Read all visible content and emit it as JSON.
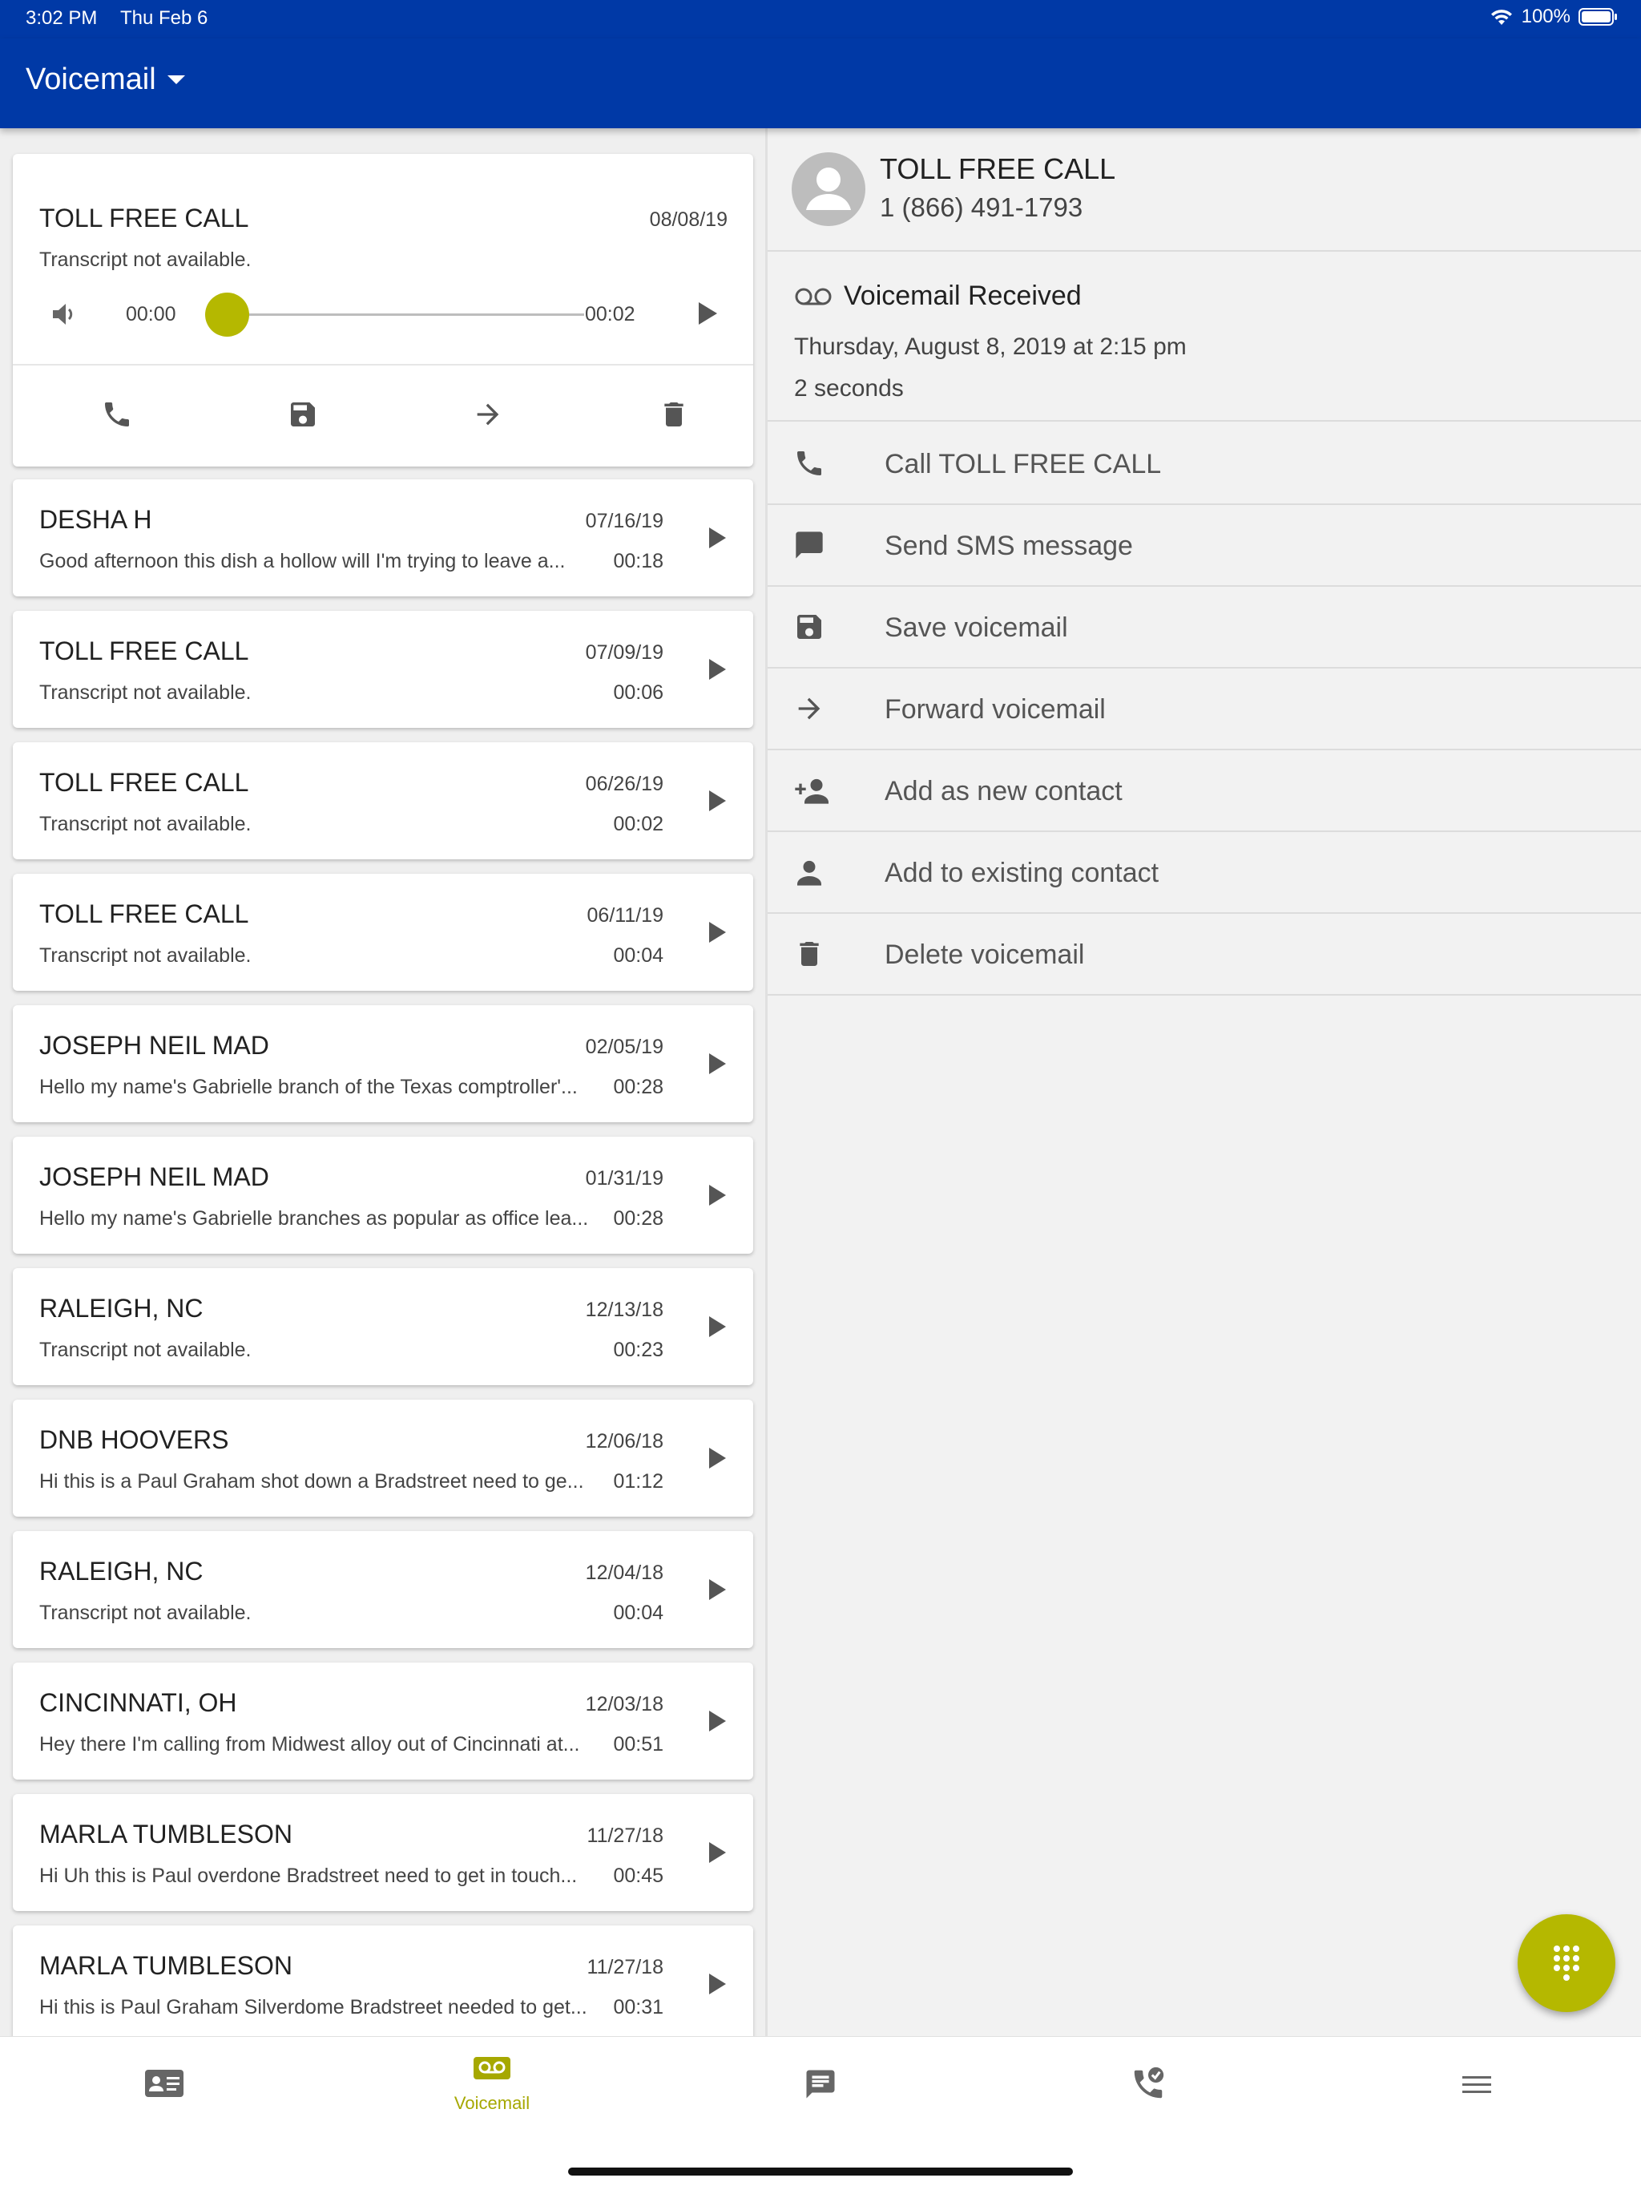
{
  "status_bar": {
    "time": "3:02 PM",
    "date": "Thu Feb 6",
    "battery": "100%"
  },
  "app_bar": {
    "title": "Voicemail"
  },
  "colors": {
    "primary": "#0039a6",
    "accent": "#b5b800"
  },
  "selected_voicemail": {
    "name": "TOLL FREE CALL",
    "date": "08/08/19",
    "snippet": "Transcript not available.",
    "position": "00:00",
    "duration": "00:02",
    "progress": 0
  },
  "voicemails": [
    {
      "name": "DESHA H",
      "date": "07/16/19",
      "snippet": "Good afternoon this dish a hollow will I'm trying to leave a...",
      "duration": "00:18"
    },
    {
      "name": "TOLL FREE CALL",
      "date": "07/09/19",
      "snippet": "Transcript not available.",
      "duration": "00:06"
    },
    {
      "name": "TOLL FREE CALL",
      "date": "06/26/19",
      "snippet": "Transcript not available.",
      "duration": "00:02"
    },
    {
      "name": "TOLL FREE CALL",
      "date": "06/11/19",
      "snippet": "Transcript not available.",
      "duration": "00:04"
    },
    {
      "name": "JOSEPH NEIL MAD",
      "date": "02/05/19",
      "snippet": "Hello my name's Gabrielle branch of the Texas comptroller'...",
      "duration": "00:28"
    },
    {
      "name": "JOSEPH NEIL MAD",
      "date": "01/31/19",
      "snippet": "Hello my name's Gabrielle branches as popular as office lea...",
      "duration": "00:28"
    },
    {
      "name": "RALEIGH, NC",
      "date": "12/13/18",
      "snippet": "Transcript not available.",
      "duration": "00:23"
    },
    {
      "name": "DNB HOOVERS",
      "date": "12/06/18",
      "snippet": "Hi this is a Paul Graham shot down a Bradstreet need to ge...",
      "duration": "01:12"
    },
    {
      "name": "RALEIGH, NC",
      "date": "12/04/18",
      "snippet": "Transcript not available.",
      "duration": "00:04"
    },
    {
      "name": "CINCINNATI, OH",
      "date": "12/03/18",
      "snippet": "Hey there I'm calling from Midwest alloy out of Cincinnati at...",
      "duration": "00:51"
    },
    {
      "name": "MARLA TUMBLESON",
      "date": "11/27/18",
      "snippet": "Hi Uh this is Paul overdone Bradstreet need to get in touch...",
      "duration": "00:45"
    },
    {
      "name": "MARLA TUMBLESON",
      "date": "11/27/18",
      "snippet": "Hi this is Paul Graham Silverdome Bradstreet needed to get...",
      "duration": "00:31"
    }
  ],
  "detail": {
    "contact_name": "TOLL FREE CALL",
    "contact_number": "1 (866) 491-1793",
    "vm_title": "Voicemail Received",
    "vm_datetime": "Thursday, August 8, 2019 at 2:15 pm",
    "vm_length": "2 seconds",
    "actions": [
      {
        "label": "Call TOLL FREE CALL",
        "icon": "phone-icon"
      },
      {
        "label": "Send SMS message",
        "icon": "message-icon"
      },
      {
        "label": "Save voicemail",
        "icon": "save-icon"
      },
      {
        "label": "Forward voicemail",
        "icon": "forward-arrow-icon"
      },
      {
        "label": "Add as new contact",
        "icon": "add-person-icon"
      },
      {
        "label": "Add to existing contact",
        "icon": "person-icon"
      },
      {
        "label": "Delete voicemail",
        "icon": "trash-icon"
      }
    ]
  },
  "bottom_nav": [
    {
      "label": "",
      "icon": "contacts-card-icon"
    },
    {
      "label": "Voicemail",
      "icon": "voicemail-icon",
      "active": true
    },
    {
      "label": "",
      "icon": "chat-icon"
    },
    {
      "label": "",
      "icon": "call-history-icon"
    },
    {
      "label": "",
      "icon": "menu-icon"
    }
  ]
}
